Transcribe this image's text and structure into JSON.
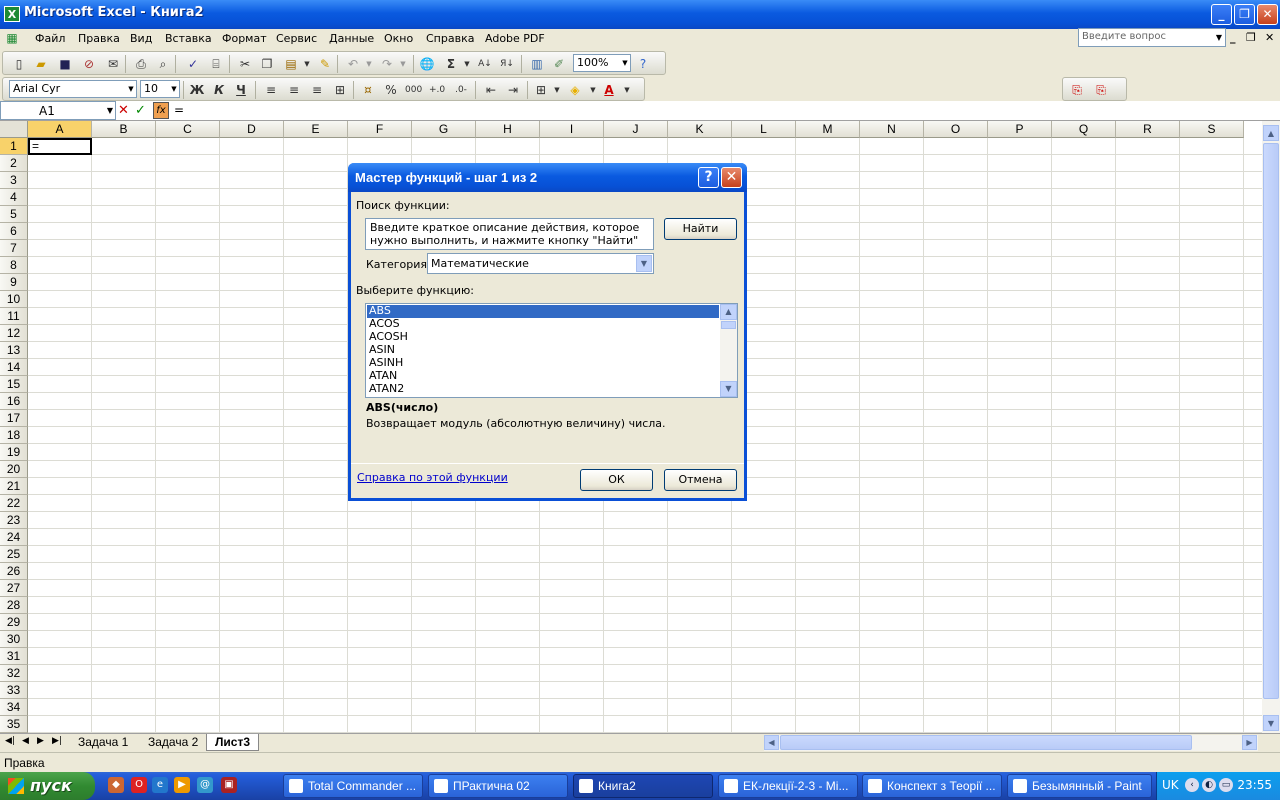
{
  "window": {
    "title": "Microsoft Excel - Книга2",
    "app_icon": "X"
  },
  "menu": {
    "items": [
      "Файл",
      "Правка",
      "Вид",
      "Вставка",
      "Формат",
      "Сервис",
      "Данные",
      "Окно",
      "Справка",
      "Adobe PDF"
    ],
    "ask_placeholder": "Введите вопрос"
  },
  "toolbar": {
    "zoom": "100%",
    "font": "Arial Cyr",
    "size": "10",
    "bold": "Ж",
    "italic": "К",
    "underline": "Ч",
    "percent": "%",
    "thousands": "000"
  },
  "formula_bar": {
    "name_box": "A1",
    "formula": "="
  },
  "grid": {
    "columns": [
      "A",
      "B",
      "C",
      "D",
      "E",
      "F",
      "G",
      "H",
      "I",
      "J",
      "K",
      "L",
      "M",
      "N",
      "O",
      "P",
      "Q",
      "R",
      "S"
    ],
    "rows": [
      "1",
      "2",
      "3",
      "4",
      "5",
      "6",
      "7",
      "8",
      "9",
      "10",
      "11",
      "12",
      "13",
      "14",
      "15",
      "16",
      "17",
      "18",
      "19",
      "20",
      "21",
      "22",
      "23",
      "24",
      "25",
      "26",
      "27",
      "28",
      "29",
      "30",
      "31",
      "32",
      "33",
      "34",
      "35"
    ],
    "active_cell_value": "="
  },
  "sheets": [
    "Задача 1",
    "Задача 2",
    "Лист3"
  ],
  "status": "Правка",
  "dialog": {
    "title": "Мастер функций - шаг 1 из 2",
    "help_btn": "?",
    "close_btn": "✕",
    "search_label": "Поиск функции:",
    "search_text": "Введите краткое описание действия, которое нужно выполнить, и нажмите кнопку \"Найти\"",
    "find_button": "Найти",
    "category_label": "Категория:",
    "category_value": "Математические",
    "choose_label": "Выберите функцию:",
    "functions": [
      "ABS",
      "ACOS",
      "ACOSH",
      "ASIN",
      "ASINH",
      "ATAN",
      "ATAN2"
    ],
    "syntax": "ABS(число)",
    "description": "Возвращает модуль (абсолютную величину) числа.",
    "help_link": "Справка по этой функции",
    "ok": "ОК",
    "cancel": "Отмена"
  },
  "taskbar": {
    "start": "пуск",
    "tasks": [
      "Total Commander ...",
      "ПРактична 02",
      "Книга2",
      "ЕК-лекції-2-3 - Mi...",
      "Конспект з Теорії ...",
      "Безымянный - Paint"
    ],
    "lang": "UK",
    "clock": "23:55"
  }
}
